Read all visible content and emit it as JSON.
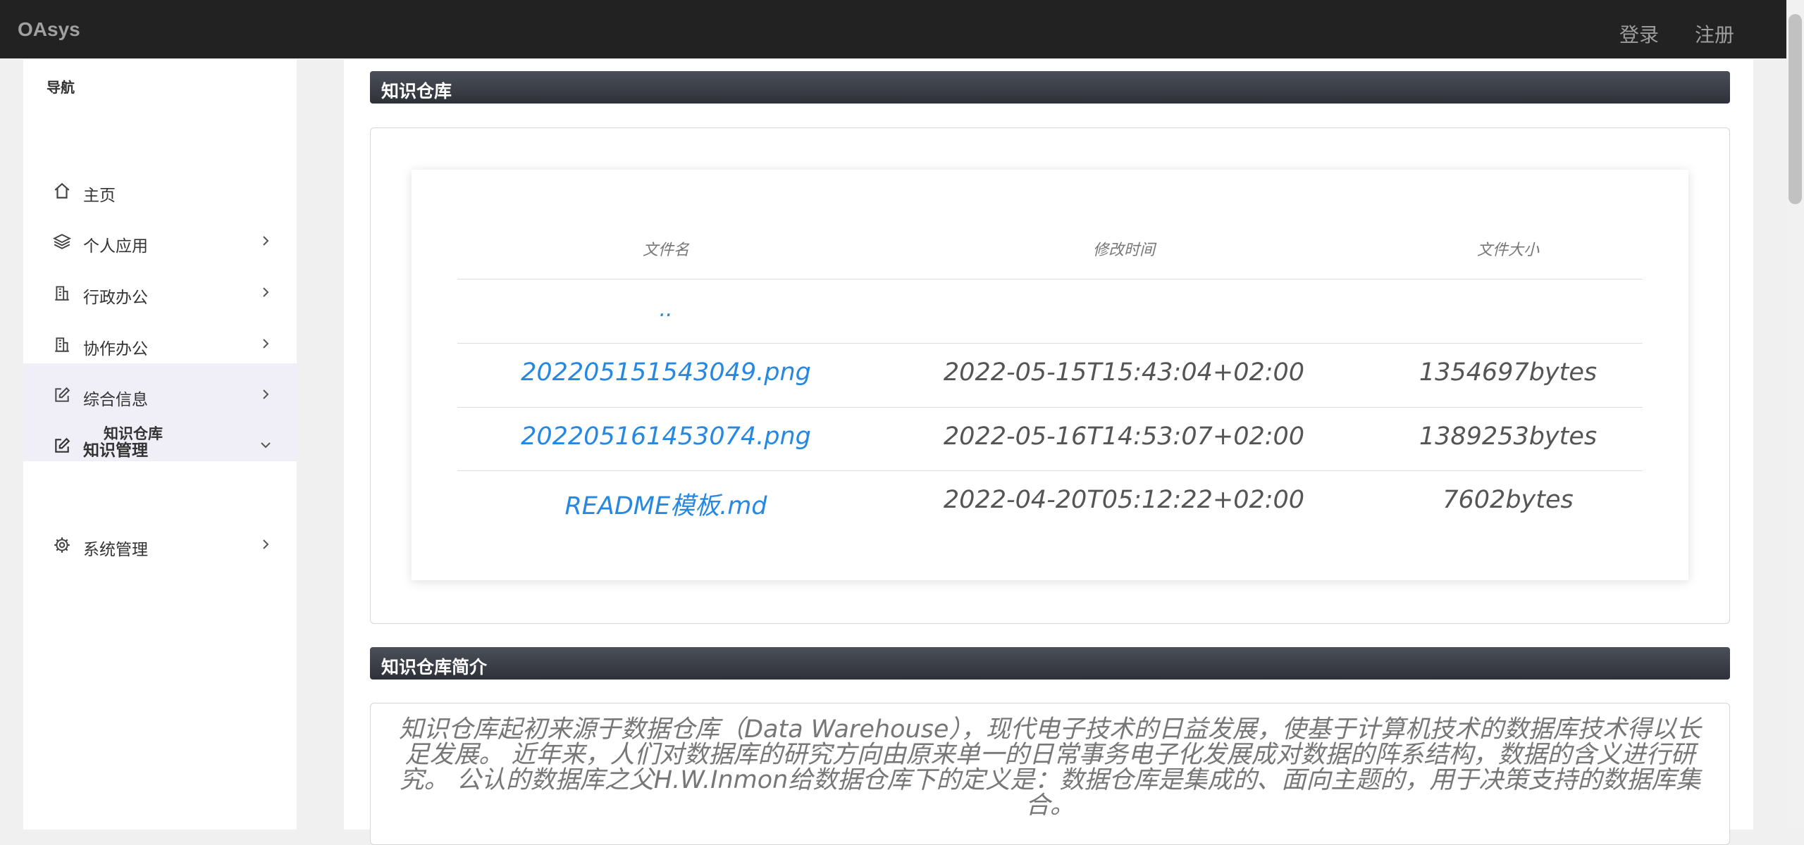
{
  "brand": "OAsys",
  "header": {
    "login_label": "登录",
    "register_label": "注册"
  },
  "sidebar": {
    "title": "导航",
    "items": [
      {
        "label": "主页",
        "icon": "home-icon",
        "expandable": false
      },
      {
        "label": "个人应用",
        "icon": "layers-icon",
        "expandable": true
      },
      {
        "label": "行政办公",
        "icon": "building-icon",
        "expandable": true
      },
      {
        "label": "协作办公",
        "icon": "building-icon",
        "expandable": true
      },
      {
        "label": "综合信息",
        "icon": "edit-icon",
        "expandable": true
      },
      {
        "label": "知识管理",
        "icon": "edit-icon",
        "expandable": true,
        "expanded": true,
        "active": true
      },
      {
        "label": "系统管理",
        "icon": "gear-icon",
        "expandable": true
      }
    ],
    "active_sub_item": "知识仓库"
  },
  "repository": {
    "header": "知识仓库",
    "columns": [
      "文件名",
      "修改时间",
      "文件大小"
    ],
    "parent_link": "..",
    "files": [
      {
        "name": "202205151543049.png",
        "modified": "2022-05-15T15:43:04+02:00",
        "size": "1354697bytes"
      },
      {
        "name": "202205161453074.png",
        "modified": "2022-05-16T14:53:07+02:00",
        "size": "1389253bytes"
      },
      {
        "name": "README模板.md",
        "modified": "2022-04-20T05:12:22+02:00",
        "size": "7602bytes"
      }
    ]
  },
  "intro": {
    "header": "知识仓库简介",
    "text": "知识仓库起初来源于数据仓库（Data Warehouse），现代电子技术的日益发展，使基于计算机技术的数据库技术得以长足发展。 近年来，人们对数据库的研究方向由原来单一的日常事务电子化发展成对数据的阵系结构，数据的含义进行研究。 公认的数据库之父H.W.Inmon给数据仓库下的定义是：数据仓库是集成的、面向主题的，用于决策支持的数据库集合。"
  },
  "colors": {
    "topbar": "#222222",
    "header_bar": "#3a3d45",
    "link": "#2688e0",
    "active_nav_bg": "#f0eff7"
  }
}
